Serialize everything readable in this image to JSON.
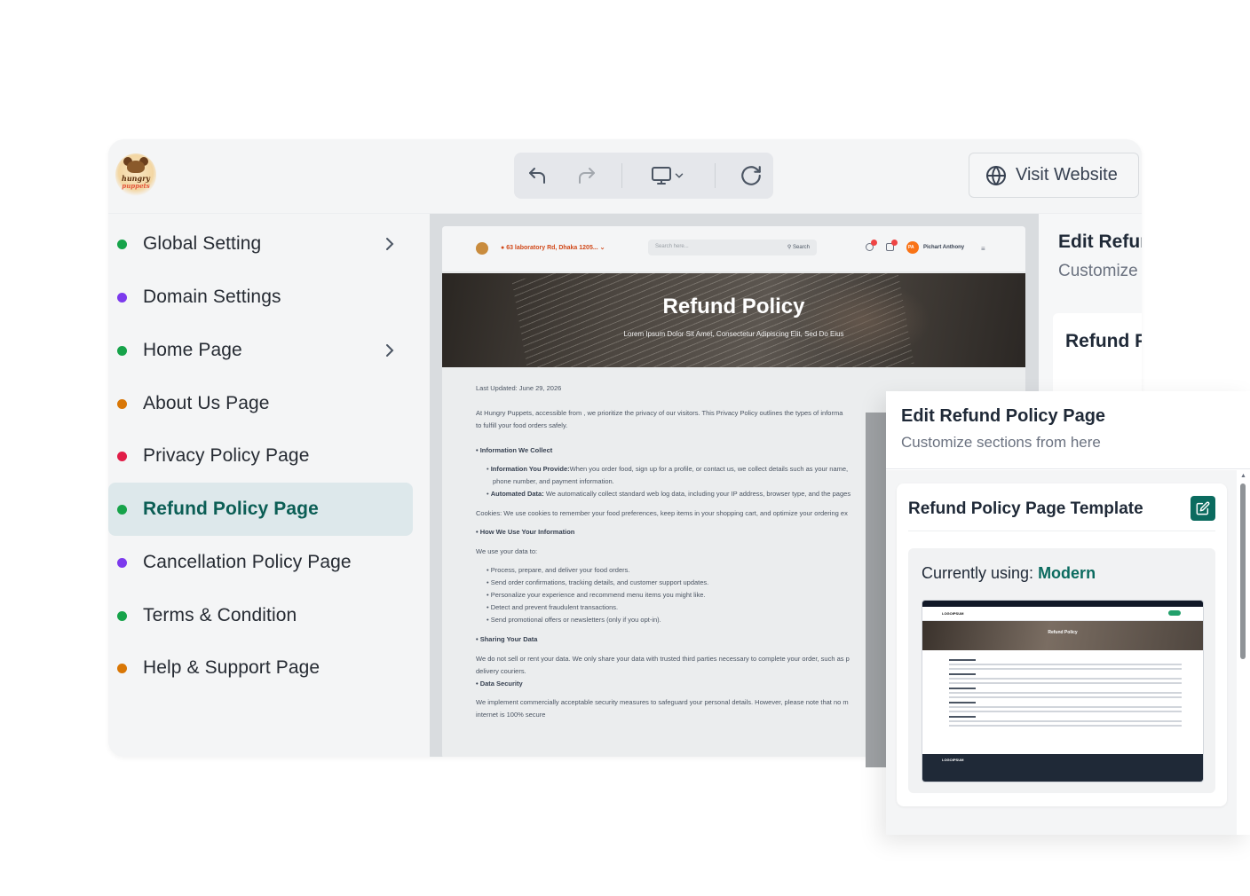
{
  "app": {
    "logo_line1": "hungry",
    "logo_line2": "puppets",
    "visit_label": "Visit Website"
  },
  "sidebar": {
    "items": [
      {
        "label": "Global Setting",
        "dot": "#16a34a"
      },
      {
        "label": "Domain Settings",
        "dot": "#7c3aed"
      },
      {
        "label": "Home Page",
        "dot": "#16a34a"
      },
      {
        "label": "About Us Page",
        "dot": "#d97706"
      },
      {
        "label": "Privacy Policy Page",
        "dot": "#e11d48"
      },
      {
        "label": "Refund Policy Page",
        "dot": "#16a34a"
      },
      {
        "label": "Cancellation Policy Page",
        "dot": "#7c3aed"
      },
      {
        "label": "Terms & Condition",
        "dot": "#16a34a"
      },
      {
        "label": "Help & Support Page",
        "dot": "#d97706"
      }
    ]
  },
  "preview": {
    "location": "63 laboratory Rd, Dhaka 1205...",
    "search_placeholder": "Search here...",
    "search_btn": "Search",
    "user_initials": "PA",
    "user_name": "Pichart Anthony",
    "hero_title": "Refund Policy",
    "hero_subtitle": "Lorem Ipsum Dolor Sit Amet, Consectetur Adipiscing Elit, Sed Do Eius",
    "last_updated": "Last Updated: June 29, 2026",
    "intro": "At Hungry Puppets, accessible from , we prioritize the privacy of our visitors. This Privacy Policy outlines the types of informa",
    "intro2": "to fulfill your food orders safely.",
    "h_collect": "• Information We Collect",
    "b1_label": "Information You Provide:",
    "b1_text": "When you order food, sign up for a profile, or contact us, we collect details such as your name,",
    "b1_cont": "phone number, and payment information.",
    "b2_label": "Automated Data:",
    "b2_text": " We automatically collect standard web log data, including your IP address, browser type, and the pages",
    "cookies": "Cookies: We use cookies to remember your food preferences, keep items in your shopping cart, and optimize your ordering ex",
    "h_use": "• How We Use Your Information",
    "use_intro": "We use your data to:",
    "use_items": [
      "Process, prepare, and deliver your food orders.",
      "Send order confirmations, tracking details, and customer support updates.",
      "Personalize your experience and recommend menu items you might like.",
      "Detect and prevent fraudulent transactions.",
      "Send promotional offers or newsletters (only if you opt-in)."
    ],
    "h_share": "• Sharing Your Data",
    "share": "We do not sell or rent your data. We only share your data with trusted third parties necessary to complete your order, such as p",
    "share2": "delivery couriers.",
    "h_security": "• Data Security",
    "security": "We implement commercially acceptable security measures to safeguard your personal details. However, please note that no m",
    "security2": "internet is 100% secure"
  },
  "edit_bg": {
    "title": "Edit Refund Policy Page",
    "subtitle": "Customize sections from here",
    "card_title": "Refund Policy Page Template"
  },
  "panel": {
    "title": "Edit Refund Policy Page",
    "subtitle": "Customize sections from here",
    "card_title": "Refund Policy Page Template",
    "using_label": "Currently using: ",
    "using_value": "Modern",
    "thumb_logo": "LOGOIPSUM",
    "thumb_title": "Refund Policy",
    "thumb_footer_logo": "LOGOIPSUM"
  },
  "colors": {
    "accent": "#0b6b5f",
    "active_bg": "#dde8eb"
  }
}
